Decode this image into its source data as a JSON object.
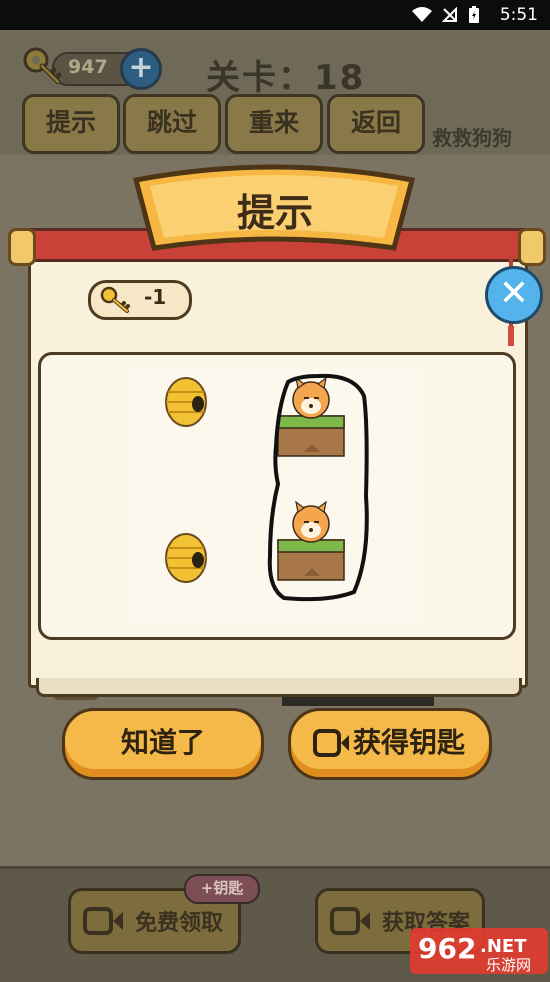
{
  "status_bar": {
    "time": "5:51",
    "icons": [
      "wifi-icon",
      "signal-off-icon",
      "battery-icon"
    ]
  },
  "header": {
    "keys": "947",
    "level_label": "关卡：18",
    "buttons": [
      "提示",
      "跳过",
      "重来",
      "返回"
    ],
    "game_name": "救救狗狗"
  },
  "dialog": {
    "title": "提示",
    "cost": "-1",
    "confirm_label": "知道了",
    "get_keys_label": "获得钥匙"
  },
  "bottom": {
    "free_label": "免费领取",
    "badge": "+钥匙",
    "answer_label": "获取答案"
  },
  "watermark": {
    "number": "962",
    "suffix": ".NET",
    "subtitle": "乐游网"
  },
  "colors": {
    "accent_orange": "#f5b94a",
    "close_blue": "#55b3ec",
    "scroll_red": "#c94137",
    "paper": "#faf1dc"
  }
}
